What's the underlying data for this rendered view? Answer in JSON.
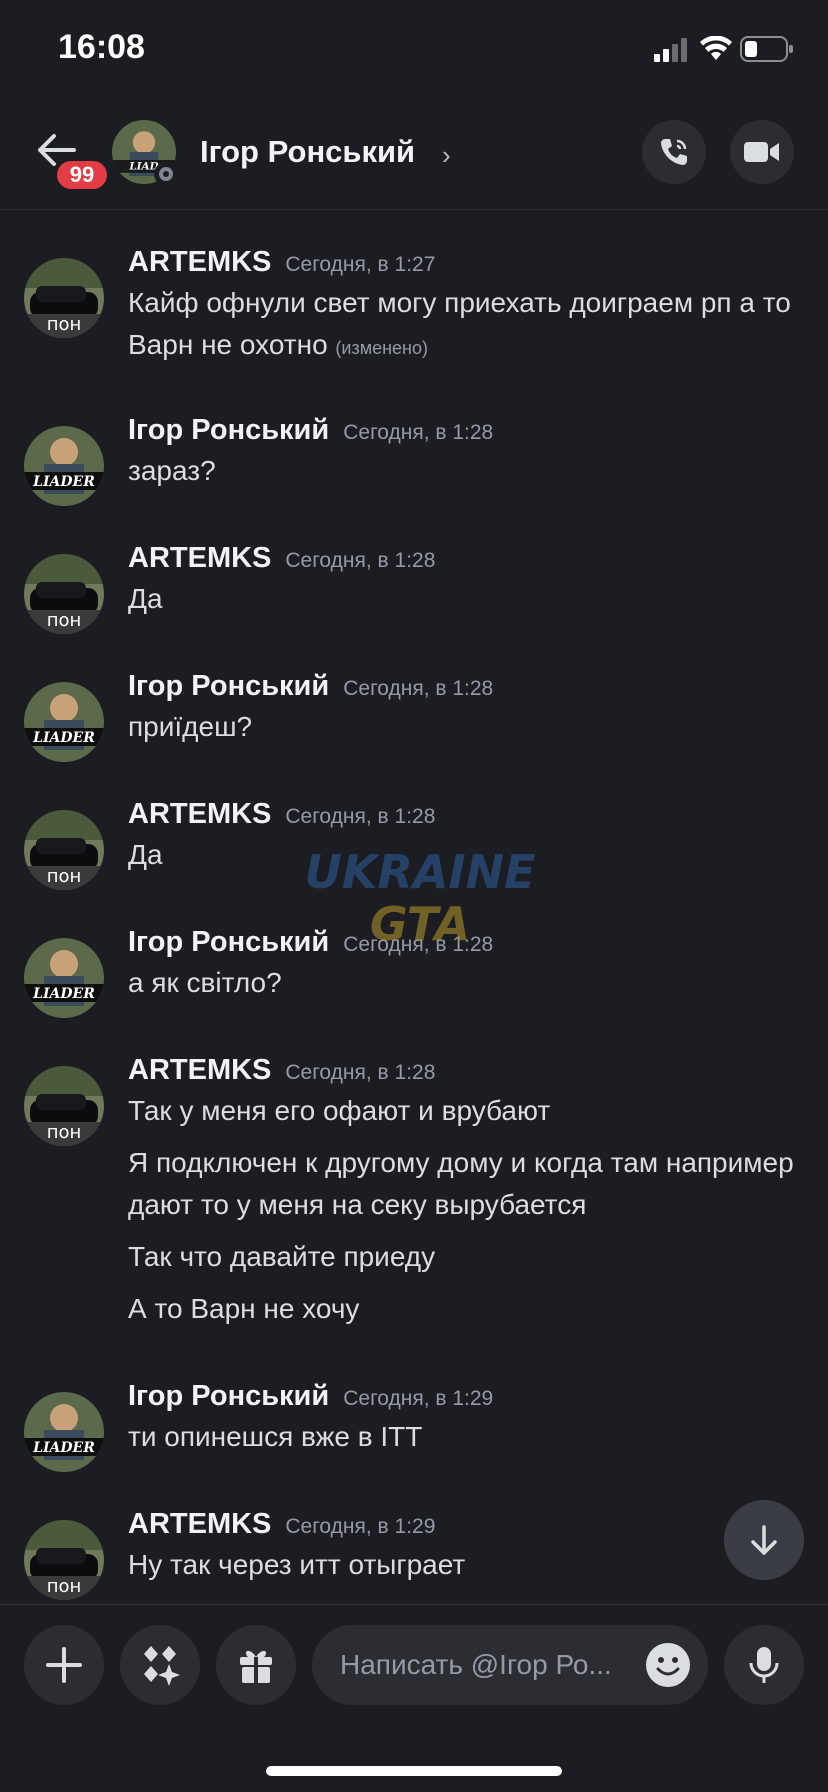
{
  "status_bar": {
    "time": "16:08"
  },
  "header": {
    "unread_count": "99",
    "name": "Ігор Ронський",
    "chevron": "›",
    "call_icon": "phone-icon",
    "video_icon": "video-camera-icon"
  },
  "avatar_labels": {
    "car": "пон",
    "leader": "LIADER"
  },
  "messages": [
    {
      "author": "ARTEMKS",
      "time": "Сегодня, в 1:27",
      "lines": [
        "Кайф офнули свет могу приехать доиграем рп а то Варн не охотно"
      ],
      "edited": "(изменено)"
    },
    {
      "author": "Ігор Ронський",
      "time": "Сегодня, в 1:28",
      "lines": [
        "зараз?"
      ]
    },
    {
      "author": "ARTEMKS",
      "time": "Сегодня, в 1:28",
      "lines": [
        "Да"
      ]
    },
    {
      "author": "Ігор Ронський",
      "time": "Сегодня, в 1:28",
      "lines": [
        "приїдеш?"
      ]
    },
    {
      "author": "ARTEMKS",
      "time": "Сегодня, в 1:28",
      "lines": [
        "Да"
      ]
    },
    {
      "author": "Ігор Ронський",
      "time": "Сегодня, в 1:28",
      "lines": [
        "а як світло?"
      ]
    },
    {
      "author": "ARTEMKS",
      "time": "Сегодня, в 1:28",
      "lines": [
        "Так у меня его офают и врубают",
        "Я подключен к другому дому и когда там например дают то у меня на секу вырубается",
        "Так что давайте приеду",
        "А то Варн не хочу"
      ]
    },
    {
      "author": "Ігор Ронський",
      "time": "Сегодня, в 1:29",
      "lines": [
        "ти опинешся вже в ІТТ"
      ]
    },
    {
      "author": "ARTEMKS",
      "time": "Сегодня, в 1:29",
      "lines": [
        "Ну так через итт отыграет"
      ]
    }
  ],
  "watermark": {
    "line1": "UKRAINE",
    "line2": "GTA"
  },
  "composer": {
    "placeholder": "Написать @Ігор Ро..."
  },
  "colors": {
    "background": "#1c1d22",
    "badge": "#e23d45",
    "button_bg": "#2b2d33"
  }
}
